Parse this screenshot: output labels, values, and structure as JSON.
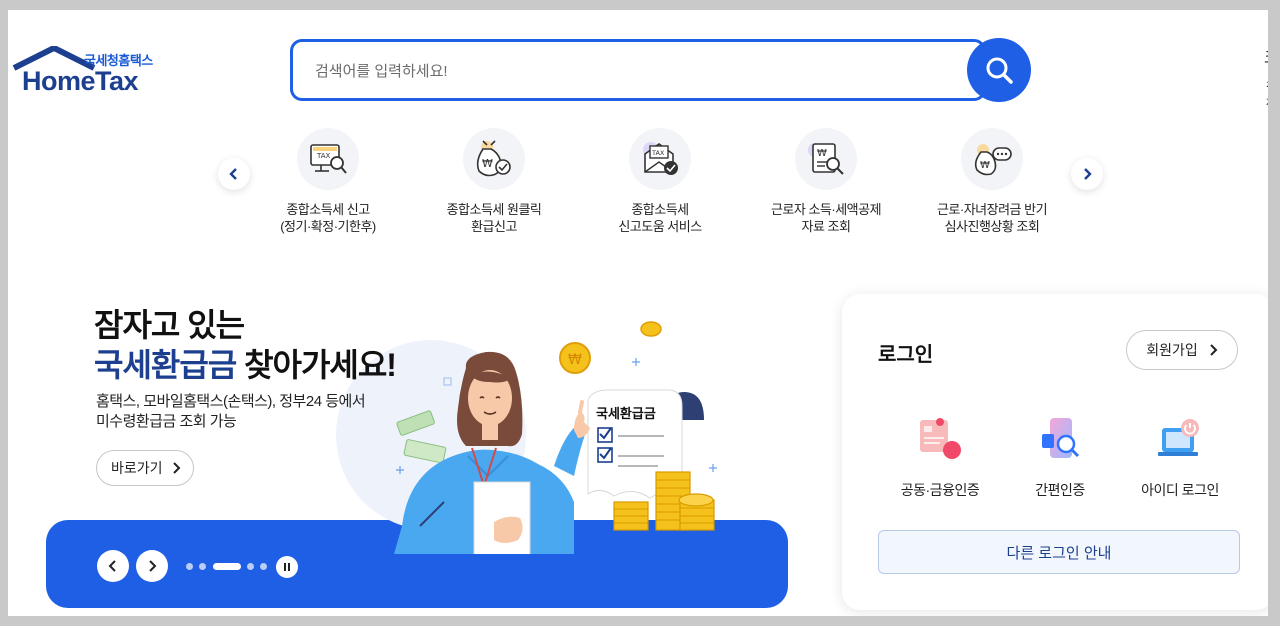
{
  "logo": {
    "sub": "국세청홈택스",
    "main": "HomeTax"
  },
  "search": {
    "placeholder": "검색어를 입력하세요!"
  },
  "header_cut": {
    "top": "크",
    "bottom": "전체"
  },
  "quick_menu": [
    {
      "line1": "종합소득세 신고",
      "line2": "(정기·확정·기한후)",
      "icon": "tax-search-icon"
    },
    {
      "line1": "종합소득세 원클릭",
      "line2": "환급신고",
      "icon": "money-bag-icon"
    },
    {
      "line1": "종합소득세",
      "line2": "신고도움 서비스",
      "icon": "tax-envelope-icon"
    },
    {
      "line1": "근로자 소득·세액공제",
      "line2": "자료 조회",
      "icon": "receipt-search-icon"
    },
    {
      "line1": "근로·자녀장려금 반기",
      "line2": "심사진행상황 조회",
      "icon": "money-chat-icon"
    }
  ],
  "hero": {
    "title_line1": "잠자고 있는",
    "title_highlight": "국세환급금",
    "title_rest": " 찾아가세요!",
    "desc_line1": "홈택스, 모바일홈택스(손택스), 정부24 등에서",
    "desc_line2": "미수령환급금 조회 가능",
    "go_button": "바로가기",
    "sign_text": "국세환급금"
  },
  "login": {
    "title": "로그인",
    "join": "회원가입",
    "options": [
      {
        "label": "공동·금융인증",
        "icon": "certificate-icon"
      },
      {
        "label": "간편인증",
        "icon": "simple-auth-icon"
      },
      {
        "label": "아이디 로그인",
        "icon": "id-login-icon"
      }
    ],
    "other": "다른 로그인 안내"
  },
  "colors": {
    "primary": "#1f5fe6",
    "brand_navy": "#1d3f8f"
  }
}
